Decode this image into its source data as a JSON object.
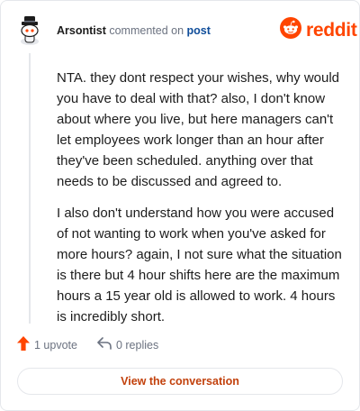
{
  "header": {
    "username": "Arsontist",
    "action_text": "commented on",
    "target_link": "post",
    "brand": "reddit"
  },
  "comment": {
    "paragraphs": [
      "NTA. they dont respect your wishes, why would you have to deal with that? also, I don't know about where you live, but here managers can't let employees work longer than an hour after they've been scheduled. anything over that needs to be discussed and agreed to.",
      "I also don't understand how you were accused of not wanting to work when you've asked for more hours? again, I not sure what the situation is there but 4 hour shifts here are the maximum hours a 15 year old is allowed to work. 4 hours is incredibly short."
    ]
  },
  "actions": {
    "upvote_label": "1 upvote",
    "replies_label": "0 replies"
  },
  "view_button": "View the conversation",
  "colors": {
    "brand": "#ff4500",
    "link": "#0f4d9a",
    "button_text": "#c2410c"
  },
  "icons": [
    "avatar",
    "reddit-logo-icon",
    "upvote-arrow-icon",
    "reply-arrow-icon"
  ]
}
